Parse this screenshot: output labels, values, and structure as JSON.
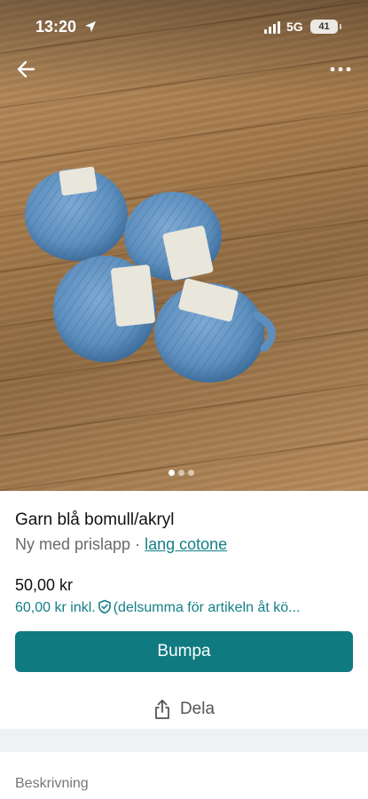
{
  "status_bar": {
    "time": "13:20",
    "network": "5G",
    "battery": "41",
    "icons": [
      "location-arrow-icon",
      "signal-bars-icon",
      "battery-icon"
    ]
  },
  "nav": {
    "back_icon": "arrow-left-icon",
    "more_icon": "more-horizontal-icon"
  },
  "gallery": {
    "image_count": 3,
    "active_index": 0
  },
  "listing": {
    "title": "Garn blå bomull/akryl",
    "condition": "Ny med prislapp",
    "separator": "·",
    "brand": "lang cotone",
    "price": "50,00 kr",
    "price_incl": "60,00 kr inkl.",
    "price_incl_note": "(delsumma för artikeln åt kö..."
  },
  "actions": {
    "bump_label": "Bumpa",
    "share_label": "Dela",
    "share_icon": "share-upload-icon"
  },
  "description": {
    "heading": "Beskrivning"
  },
  "colors": {
    "accent": "#0f7a80",
    "link": "#137f86",
    "yarn": "#5d8fbe"
  }
}
